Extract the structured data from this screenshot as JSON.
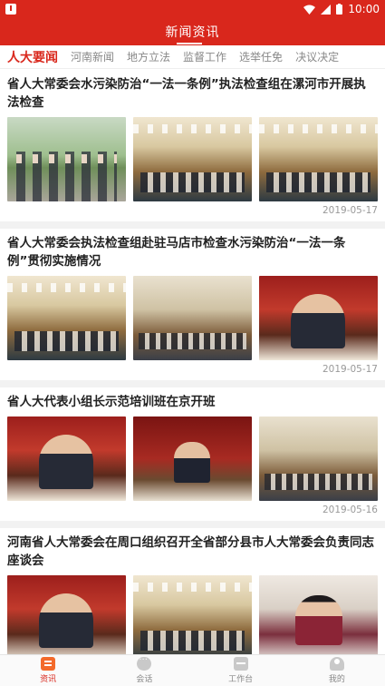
{
  "status_bar": {
    "time": "10:00"
  },
  "header": {
    "title": "新闻资讯"
  },
  "tabs": [
    {
      "label": "人大要闻",
      "active": true
    },
    {
      "label": "河南新闻",
      "active": false
    },
    {
      "label": "地方立法",
      "active": false
    },
    {
      "label": "监督工作",
      "active": false
    },
    {
      "label": "选举任免",
      "active": false
    },
    {
      "label": "决议决定",
      "active": false
    }
  ],
  "articles": [
    {
      "title": "省人大常委会水污染防治“一法一条例”执法检查组在漯河市开展执法检查",
      "date": "2019-05-17",
      "images": [
        "outdoor-inspection-photo",
        "meeting-hall-photo",
        "meeting-hall-photo"
      ]
    },
    {
      "title": "省人大常委会执法检查组赴驻马店市检查水污染防治“一法一条例”贯彻实施情况",
      "date": "2019-05-17",
      "images": [
        "meeting-hall-photo",
        "meeting-room-photo",
        "speaker-portrait-photo"
      ]
    },
    {
      "title": "省人大代表小组长示范培训班在京开班",
      "date": "2019-05-16",
      "images": [
        "red-stage-photo",
        "podium-speaker-photo",
        "classroom-photo"
      ]
    },
    {
      "title": "河南省人大常委会在周口组织召开全省部分县市人大常委会负责同志座谈会",
      "date": "",
      "images": [
        "red-stage-photo",
        "meeting-hall-photo",
        "woman-speaker-photo"
      ]
    }
  ],
  "bottom_nav": [
    {
      "label": "资讯",
      "icon": "news-icon",
      "active": true
    },
    {
      "label": "会话",
      "icon": "chat-icon",
      "active": false
    },
    {
      "label": "工作台",
      "icon": "workbench-icon",
      "active": false
    },
    {
      "label": "我的",
      "icon": "profile-icon",
      "active": false
    }
  ],
  "colors": {
    "brand_red": "#d9271c",
    "active_nav_icon": "#f36a2b"
  }
}
